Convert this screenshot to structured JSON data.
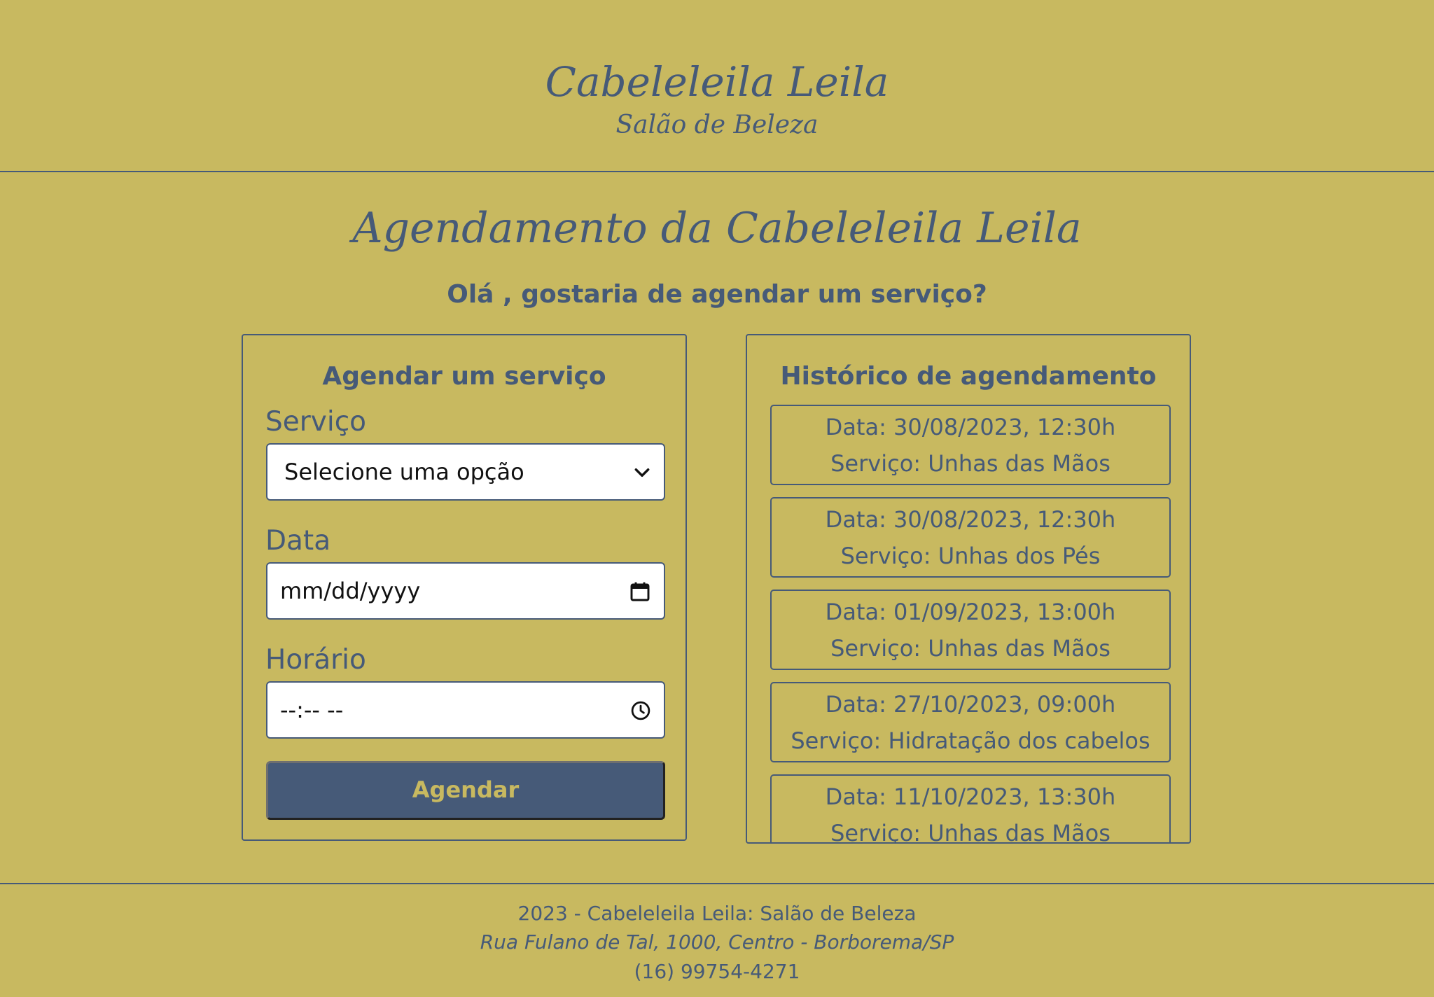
{
  "header": {
    "brand_title": "Cabeleleila Leila",
    "brand_subtitle": "Salão de Beleza"
  },
  "main": {
    "title": "Agendamento da Cabeleleila Leila",
    "greeting": "Olá , gostaria de agendar um serviço?"
  },
  "schedule_form": {
    "heading": "Agendar um serviço",
    "service_label": "Serviço",
    "service_selected": "Selecione uma opção",
    "date_label": "Data",
    "date_placeholder": "mm/dd/yyyy",
    "time_label": "Horário",
    "time_placeholder": "--:-- --",
    "submit_label": "Agendar"
  },
  "history": {
    "heading": "Histórico de agendamento",
    "items": [
      {
        "date": "Data: 30/08/2023, 12:30h",
        "service": "Serviço: Unhas das Mãos"
      },
      {
        "date": "Data: 30/08/2023, 12:30h",
        "service": "Serviço: Unhas dos Pés"
      },
      {
        "date": "Data: 01/09/2023, 13:00h",
        "service": "Serviço: Unhas das Mãos"
      },
      {
        "date": "Data: 27/10/2023, 09:00h",
        "service": "Serviço: Hidratação dos cabelos"
      },
      {
        "date": "Data: 11/10/2023, 13:30h",
        "service": "Serviço: Unhas das Mãos"
      }
    ]
  },
  "footer": {
    "copyright": "2023 - Cabeleleila Leila: Salão de Beleza",
    "address": "Rua Fulano de Tal, 1000, Centro - Borborema/SP",
    "phone": "(16) 99754-4271"
  },
  "icons": {
    "select": "chevron-down-icon",
    "date": "calendar-icon",
    "time": "clock-icon"
  },
  "colors": {
    "background": "#c8b960",
    "primary": "#465a78",
    "field_background": "#ffffff"
  }
}
